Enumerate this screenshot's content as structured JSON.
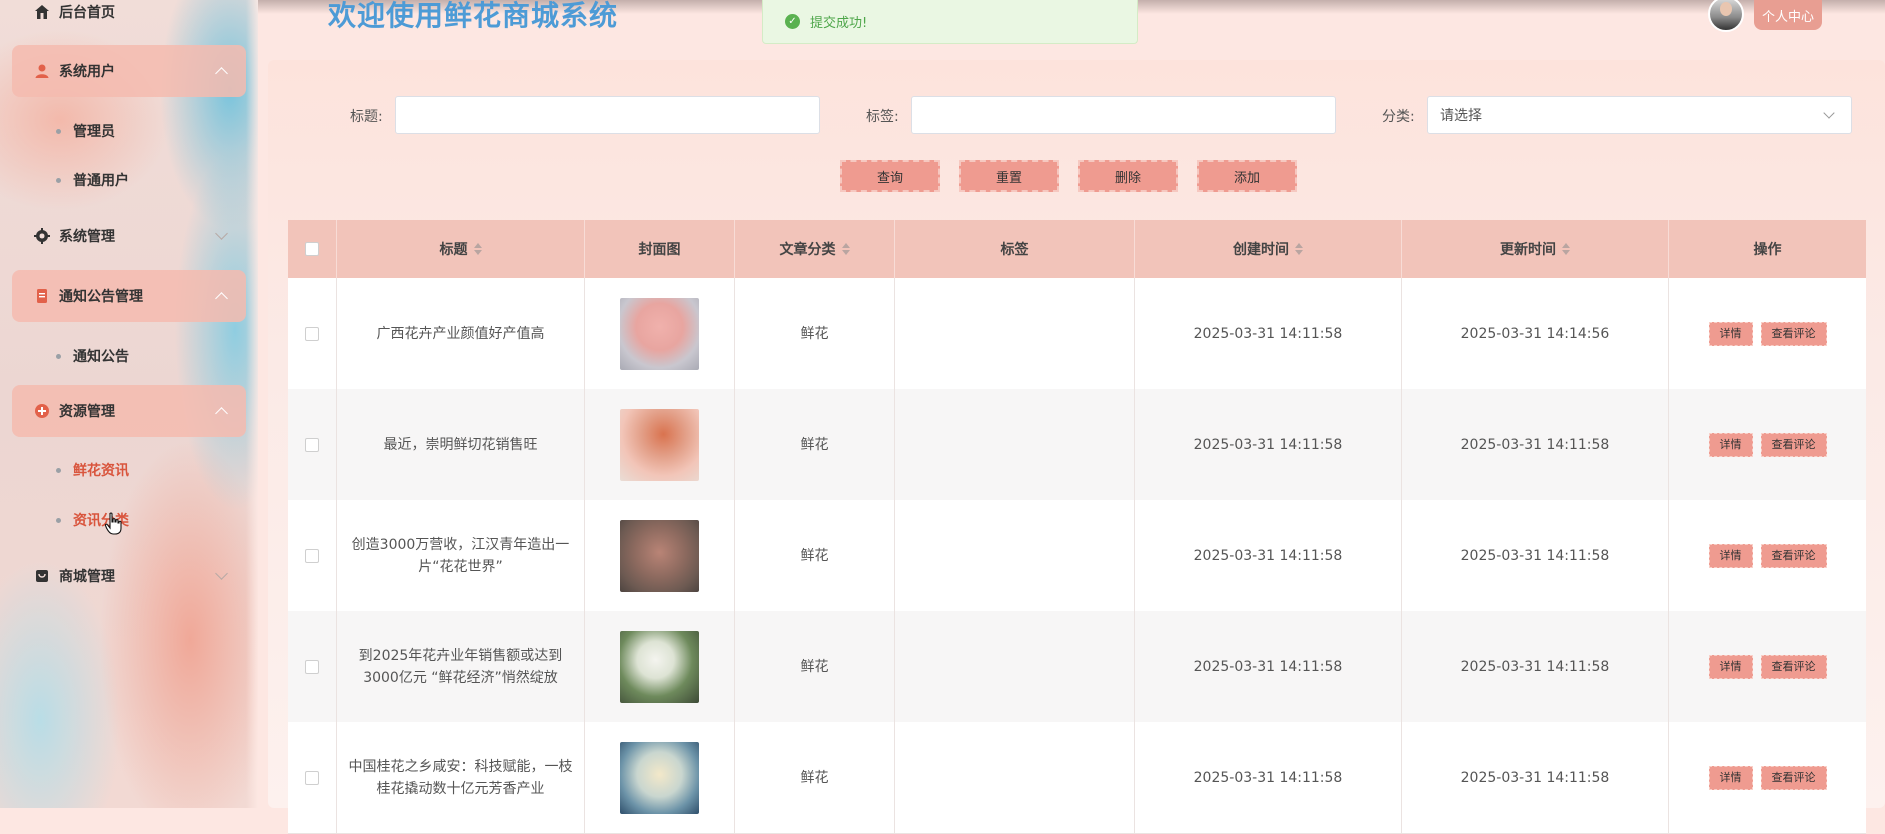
{
  "sidebar": {
    "items": [
      {
        "label": "后台首页"
      },
      {
        "label": "系统用户",
        "children": [
          "管理员",
          "普通用户"
        ]
      },
      {
        "label": "系统管理"
      },
      {
        "label": "通知公告管理",
        "children": [
          "通知公告"
        ]
      },
      {
        "label": "资源管理",
        "children": [
          "鲜花资讯",
          "资讯分类"
        ]
      },
      {
        "label": "商城管理"
      }
    ]
  },
  "header": {
    "welcome": "欢迎使用鲜花商城系统",
    "toast": "提交成功!",
    "user_center": "个人中心"
  },
  "search": {
    "title_label": "标题:",
    "tag_label": "标签:",
    "category_label": "分类:",
    "category_placeholder": "请选择",
    "title_value": "",
    "tag_value": ""
  },
  "buttons": {
    "query": "查询",
    "reset": "重置",
    "delete": "删除",
    "add": "添加"
  },
  "table": {
    "headers": [
      "标题",
      "封面图",
      "文章分类",
      "标签",
      "创建时间",
      "更新时间",
      "操作"
    ],
    "rows": [
      {
        "title": "广西花卉产业颜值好产值高",
        "category": "鲜花",
        "tag": "",
        "created": "2025-03-31 14:11:58",
        "updated": "2025-03-31 14:14:56"
      },
      {
        "title": "最近，崇明鲜切花销售旺",
        "category": "鲜花",
        "tag": "",
        "created": "2025-03-31 14:11:58",
        "updated": "2025-03-31 14:11:58"
      },
      {
        "title": "创造3000万营收，江汉青年造出一片“花花世界”",
        "category": "鲜花",
        "tag": "",
        "created": "2025-03-31 14:11:58",
        "updated": "2025-03-31 14:11:58"
      },
      {
        "title": "到2025年花卉业年销售额或达到3000亿元 “鲜花经济”悄然绽放",
        "category": "鲜花",
        "tag": "",
        "created": "2025-03-31 14:11:58",
        "updated": "2025-03-31 14:11:58"
      },
      {
        "title": "中国桂花之乡咸安：科技赋能，一枝桂花撬动数十亿元芳香产业",
        "category": "鲜花",
        "tag": "",
        "created": "2025-03-31 14:11:58",
        "updated": "2025-03-31 14:11:58"
      }
    ],
    "detail_label": "详情",
    "comment_label": "查看评论"
  },
  "colors": {
    "accent": "#ef9b90",
    "title_blue": "#4d9bd6",
    "active_menu": "#d9553d",
    "success": "#5ab150"
  }
}
